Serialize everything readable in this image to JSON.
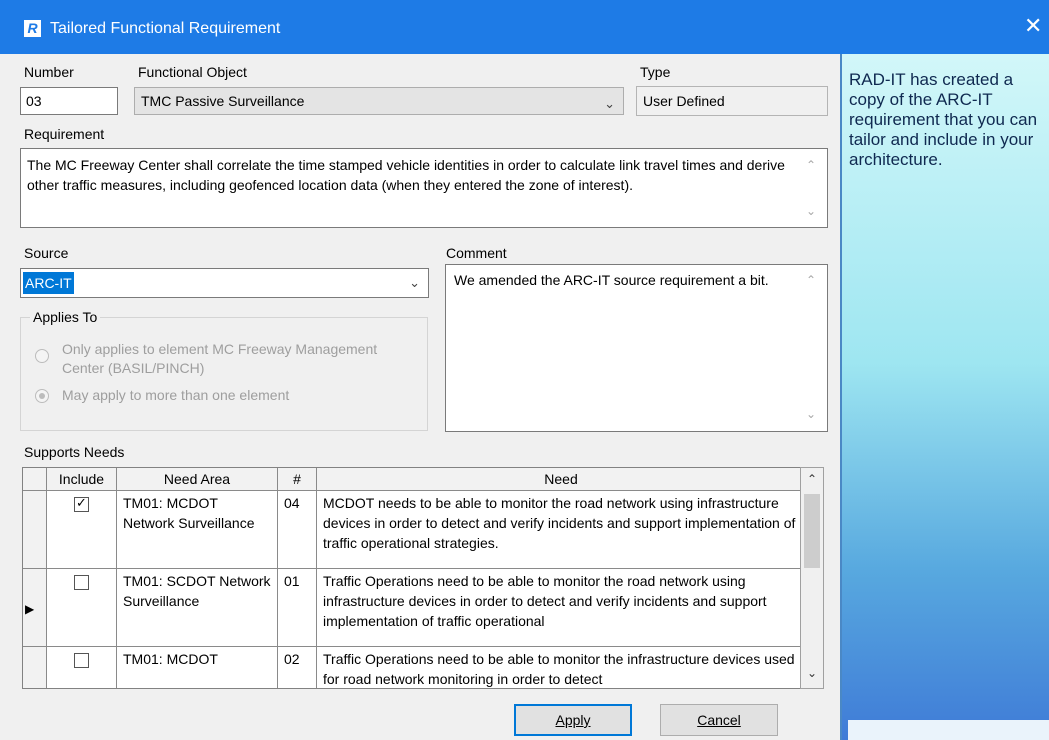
{
  "window": {
    "title": "Tailored Functional Requirement",
    "app_icon_letter": "R",
    "close_glyph": "✕"
  },
  "form": {
    "number_label": "Number",
    "number_value": "03",
    "functional_object_label": "Functional Object",
    "functional_object_value": "TMC Passive Surveillance",
    "type_label": "Type",
    "type_value": "User Defined",
    "requirement_label": "Requirement",
    "requirement_text": "The MC Freeway Center shall correlate the time stamped vehicle identities in order to calculate link travel times and derive other traffic measures, including geofenced location data (when they entered the zone of interest).",
    "source_label": "Source",
    "source_value": "ARC-IT",
    "comment_label": "Comment",
    "comment_text": "We amended the ARC-IT source requirement a bit.",
    "applies_to": {
      "legend": "Applies To",
      "option1": "Only applies to element MC Freeway Management Center (BASIL/PINCH)",
      "option2": "May apply to more than one element",
      "selected": 2
    }
  },
  "supports_needs": {
    "label": "Supports Needs",
    "columns": [
      "Include",
      "Need Area",
      "#",
      "Need"
    ],
    "rows": [
      {
        "include": true,
        "area": "TM01: MCDOT Network Surveillance",
        "num": "04",
        "need": "MCDOT needs to be able to monitor the road network using infrastructure devices in order to detect and verify incidents and support implementation of traffic operational strategies."
      },
      {
        "include": false,
        "area": "TM01: SCDOT Network Surveillance",
        "num": "01",
        "need": "Traffic Operations need to be able to monitor the road network using infrastructure devices in order to detect and verify incidents and support implementation of traffic operational"
      },
      {
        "include": false,
        "area": "TM01: MCDOT",
        "num": "02",
        "need": "Traffic Operations need to be able to monitor the infrastructure devices used for road network monitoring in order to detect"
      }
    ],
    "current_row": 2
  },
  "buttons": {
    "apply": "Apply",
    "cancel": "Cancel"
  },
  "side_panel": {
    "text": "RAD-IT has created a copy of the ARC-IT requirement that you can tailor and include in your architecture."
  },
  "colors": {
    "titlebar": "#1e7be6",
    "dialog_bg": "#f0f0f0",
    "selection": "#0078d7",
    "default_button_border": "#0078d7"
  }
}
